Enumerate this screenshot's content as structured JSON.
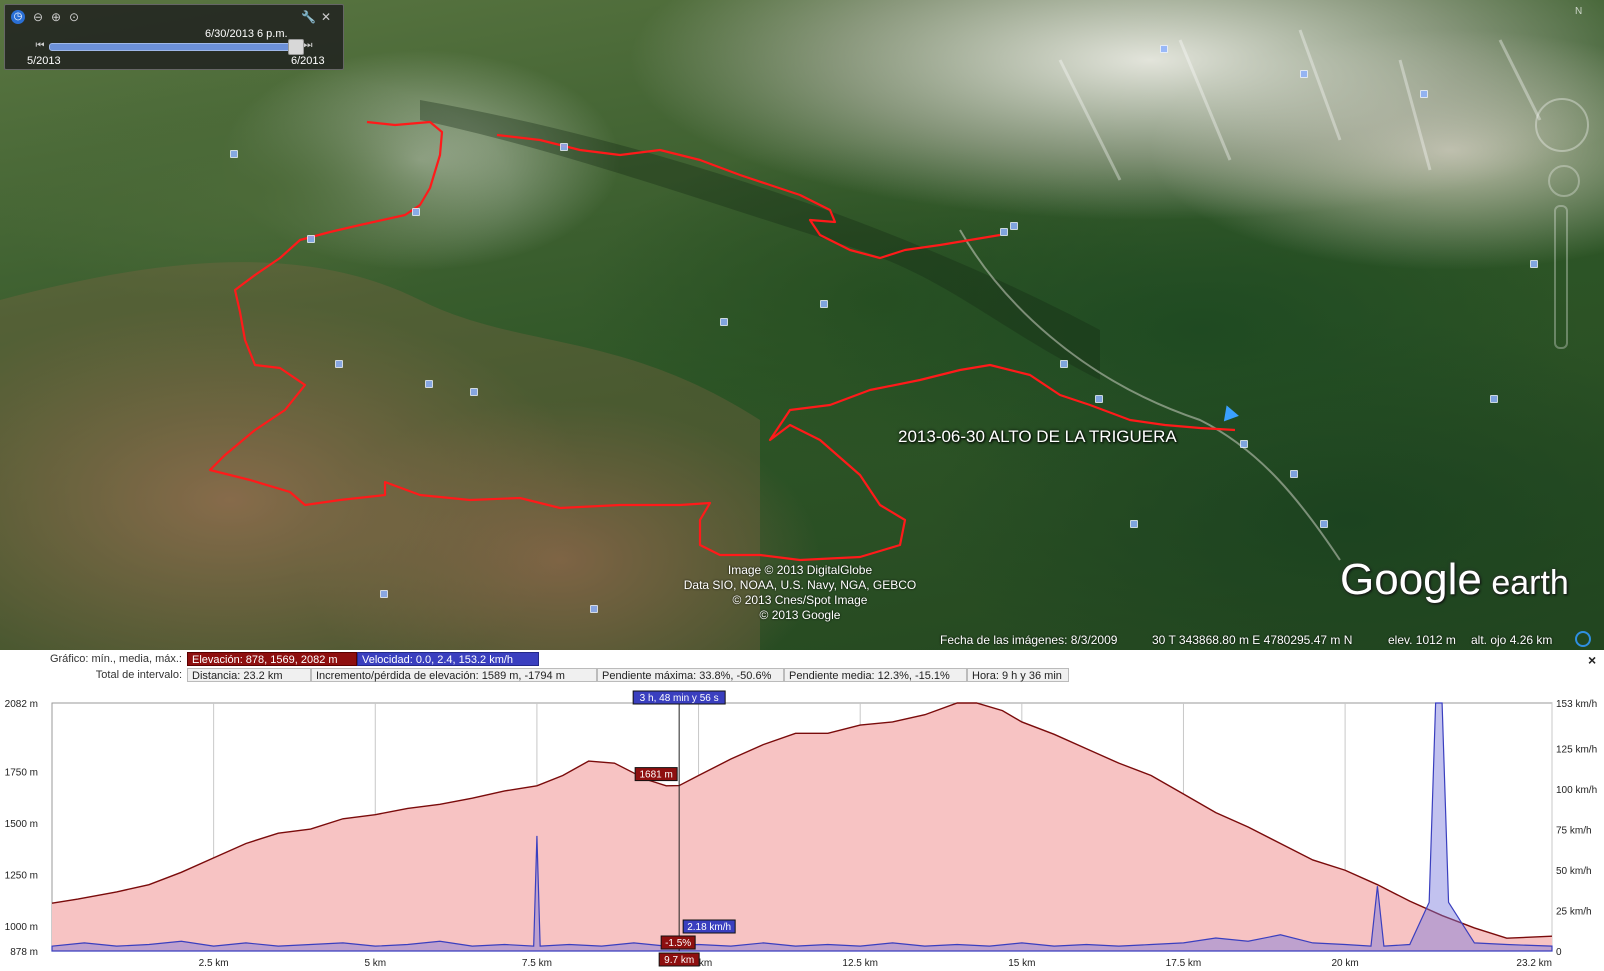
{
  "time_slider": {
    "current": "6/30/2013   6 p.m.",
    "start": "5/2013",
    "end": "6/2013"
  },
  "map": {
    "track_label": "2013-06-30 ALTO DE LA TRIGUERA",
    "credits": [
      "Image © 2013 DigitalGlobe",
      "Data SIO, NOAA, U.S. Navy, NGA, GEBCO",
      "© 2013 Cnes/Spot Image",
      "© 2013 Google"
    ],
    "brand_main": "Google",
    "brand_sub": " earth",
    "route_color": "#ff1a1a"
  },
  "status_bar": {
    "imagery_date": "Fecha de las imágenes: 8/3/2009",
    "coords": "30 T 343868.80 m E 4780295.47 m N",
    "elev": "elev.  1012 m",
    "eye_alt": "alt. ojo    4.26 km"
  },
  "profile": {
    "row1_label": "Gráfico: mín., media, máx.:",
    "elevation_summary": "Elevación: 878, 1569, 2082 m",
    "speed_summary": "Velocidad: 0.0, 2.4, 153.2 km/h",
    "row2_label": "Total de intervalo:",
    "distance": "Distancia: 23.2 km",
    "gain_loss": "Incremento/pérdida de elevación: 1589 m, -1794 m",
    "max_slope": "Pendiente máxima: 33.8%, -50.6%",
    "avg_slope": "Pendiente media: 12.3%, -15.1%",
    "time": "Hora: 9 h y 36 min",
    "close": "×",
    "cursor": {
      "time": "3 h, 48 min y 56 s",
      "elevation": "1681 m",
      "speed": "2.18 km/h",
      "slope": "-1.5%",
      "distance": "9.7 km"
    }
  },
  "chart_data": {
    "type": "area",
    "xlabel": "",
    "x_ticks": [
      "2.5 km",
      "5 km",
      "7.5 km",
      "10 km",
      "12.5 km",
      "15 km",
      "17.5 km",
      "20 km",
      "23.2 km"
    ],
    "x_tick_values": [
      2.5,
      5,
      7.5,
      10,
      12.5,
      15,
      17.5,
      20,
      23.2
    ],
    "xlim": [
      0,
      23.2
    ],
    "y_left_ticks": [
      "2082 m",
      "1750 m",
      "1500 m",
      "1250 m",
      "1000 m",
      "878 m"
    ],
    "y_left_values": [
      2082,
      1750,
      1500,
      1250,
      1000,
      878
    ],
    "y_left_range": [
      878,
      2082
    ],
    "y_right_ticks": [
      "153 km/h",
      "125 km/h",
      "100 km/h",
      "75 km/h",
      "50 km/h",
      "25 km/h",
      "0"
    ],
    "y_right_values": [
      153,
      125,
      100,
      75,
      50,
      25,
      0
    ],
    "y_right_range": [
      0,
      153
    ],
    "colors": {
      "elevation_line": "#7a0b0b",
      "elevation_fill": "#f7c3c3",
      "speed": "#3a3fbf",
      "grid": "#c8c8c8"
    },
    "series": [
      {
        "name": "Elevación",
        "x": [
          0,
          0.4,
          1,
          1.5,
          2,
          2.5,
          3,
          3.5,
          4,
          4.5,
          5,
          5.5,
          6,
          6.5,
          7,
          7.5,
          7.9,
          8.3,
          8.7,
          9.2,
          9.5,
          9.7,
          10,
          10.5,
          11,
          11.5,
          12,
          12.5,
          13,
          13.5,
          14,
          14.3,
          14.7,
          15,
          15.5,
          16,
          16.5,
          17,
          17.5,
          18,
          18.5,
          19,
          19.5,
          20,
          20.5,
          21,
          21.5,
          22,
          22.5,
          23.2
        ],
        "y": [
          1110,
          1130,
          1165,
          1200,
          1260,
          1330,
          1400,
          1450,
          1470,
          1520,
          1540,
          1570,
          1590,
          1620,
          1655,
          1680,
          1730,
          1800,
          1790,
          1710,
          1680,
          1681,
          1730,
          1810,
          1880,
          1935,
          1935,
          1975,
          1990,
          2025,
          2082,
          2082,
          2045,
          1990,
          1930,
          1860,
          1790,
          1730,
          1640,
          1550,
          1480,
          1400,
          1320,
          1270,
          1200,
          1120,
          1050,
          990,
          940,
          950
        ]
      },
      {
        "name": "Velocidad",
        "x": [
          0,
          0.5,
          1,
          1.5,
          2,
          2.5,
          3,
          3.5,
          4,
          4.5,
          5,
          5.5,
          6,
          6.5,
          7,
          7.45,
          7.5,
          7.55,
          8,
          8.5,
          9,
          9.5,
          10,
          10.5,
          11,
          11.5,
          12,
          12.5,
          13,
          13.5,
          14,
          14.5,
          15,
          15.5,
          16,
          16.5,
          17,
          17.5,
          18,
          18.5,
          19,
          19.5,
          20,
          20.4,
          20.5,
          20.6,
          21,
          21.3,
          21.4,
          21.5,
          21.6,
          22,
          22.5,
          23.2
        ],
        "y": [
          3,
          5,
          3,
          4,
          6,
          3,
          5,
          3,
          4,
          5,
          3,
          4,
          6,
          3,
          4,
          3,
          71,
          3,
          4,
          3,
          5,
          3,
          4,
          3,
          5,
          3,
          4,
          3,
          5,
          3,
          4,
          3,
          5,
          3,
          4,
          3,
          4,
          5,
          8,
          6,
          10,
          5,
          4,
          3,
          40,
          3,
          4,
          30,
          153,
          153,
          30,
          5,
          4,
          3
        ]
      }
    ]
  }
}
